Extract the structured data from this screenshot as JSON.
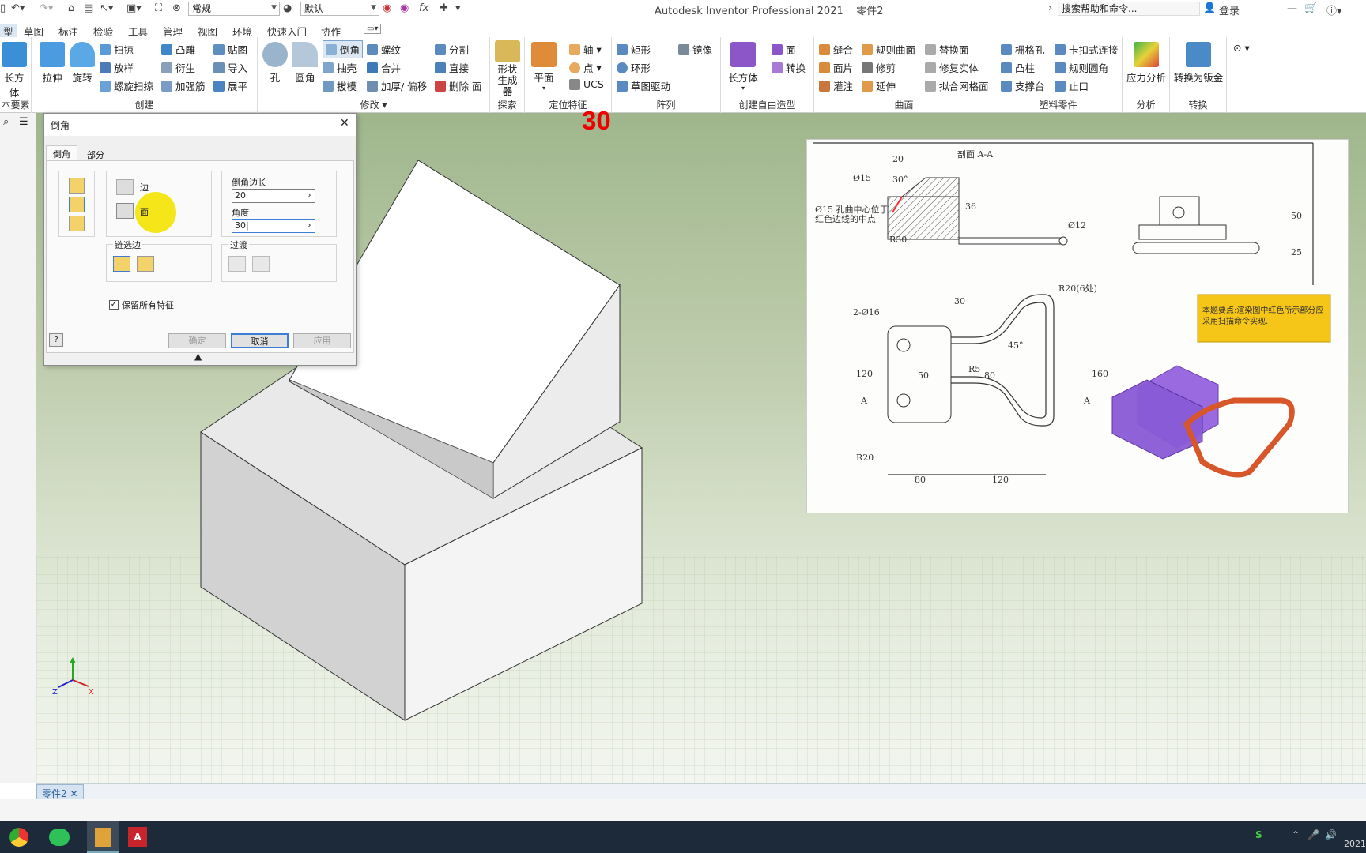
{
  "window": {
    "title": "Autodesk Inventor Professional 2021",
    "doc": "零件2",
    "search_placeholder": "搜索帮助和命令...",
    "login": "登录"
  },
  "quick": {
    "style_combo": "常规",
    "appearance_combo": "默认",
    "fx": "fx"
  },
  "tabs": [
    "型",
    "草图",
    "标注",
    "检验",
    "工具",
    "管理",
    "视图",
    "环境",
    "快速入门",
    "协作"
  ],
  "ribbon": {
    "basic": {
      "box": "长方体",
      "label": "本要素"
    },
    "create": {
      "extrude": "拉伸",
      "revolve": "旋转",
      "sweep": "扫掠",
      "loft": "放样",
      "coil": "螺旋扫掠",
      "emboss": "凸雕",
      "derive": "衍生",
      "rib": "加强筋",
      "decal": "贴图",
      "import": "导入",
      "unfold": "展平",
      "label": "创建"
    },
    "modify": {
      "hole": "孔",
      "fillet": "圆角",
      "chamfer": "倒角",
      "shell": "抽壳",
      "draft": "拔模",
      "thread": "螺纹",
      "combine": "合并",
      "thicken": "加厚/ 偏移",
      "split": "分割",
      "direct": "直接",
      "delete_face": "删除 面",
      "label": "修改"
    },
    "explore": {
      "shape": "形状\n生成器",
      "label": "探索"
    },
    "workfeat": {
      "plane": "平面",
      "axis": "轴",
      "point": "点",
      "ucs": "UCS",
      "label": "定位特征"
    },
    "pattern": {
      "rect": "矩形",
      "circ": "环形",
      "sketch": "草图驱动",
      "mirror": "镜像",
      "label": "阵列"
    },
    "freeform": {
      "box": "长方体",
      "face": "面",
      "convert": "转换",
      "label": "创建自由造型"
    },
    "surface": {
      "stitch": "缝合",
      "ruled": "规则曲面",
      "patch": "面片",
      "trim": "修剪",
      "sculpt": "灌注",
      "extend": "延伸",
      "replace": "替换面",
      "repair": "修复实体",
      "fitmesh": "拟合网格面",
      "label": "曲面"
    },
    "plastic": {
      "grill": "栅格孔",
      "snap": "卡扣式连接",
      "boss": "凸柱",
      "rulefillet": "规则圆角",
      "rest": "支撑台",
      "lip": "止口",
      "label": "塑料零件"
    },
    "analysis": {
      "stress": "应力分析",
      "label": "分析"
    },
    "convert": {
      "sheet": "转换为钣金",
      "label": "转换"
    }
  },
  "dialog": {
    "title": "倒角",
    "tab1": "倒角",
    "tab2": "部分",
    "edge_label": "边",
    "face_label": "面",
    "distance_label": "倒角边长",
    "distance_value": "20",
    "angle_label": "角度",
    "angle_value": "30",
    "chain_label": "链选边",
    "setback_label": "过渡",
    "keep_all": "保留所有特征",
    "ok": "确定",
    "cancel": "取消",
    "apply": "应用"
  },
  "overlay_number": "30",
  "drawing": {
    "section_title": "剖面 A-A",
    "note": "本题要点:渲染图中红色所示部分应采用扫描命令实现.",
    "dims": {
      "d20": "20",
      "a30": "30°",
      "phi15": "Ø15",
      "d36": "36",
      "phi12": "Ø12",
      "r30": "R30",
      "hole_note1": "Ø15 孔曲中心位于",
      "hole_note2": "红色边线的中点",
      "d50": "50",
      "d25": "25",
      "r20x6": "R20(6处)",
      "phi16": "2-Ø16",
      "d30": "30",
      "a45": "45°",
      "r5": "R5",
      "d120v": "120",
      "d50v": "50",
      "d80v": "80",
      "d160": "160",
      "r20": "R20",
      "d80": "80",
      "d120": "120",
      "A": "A"
    }
  },
  "doctab": "零件2",
  "taskbar": {
    "time": "2021"
  }
}
